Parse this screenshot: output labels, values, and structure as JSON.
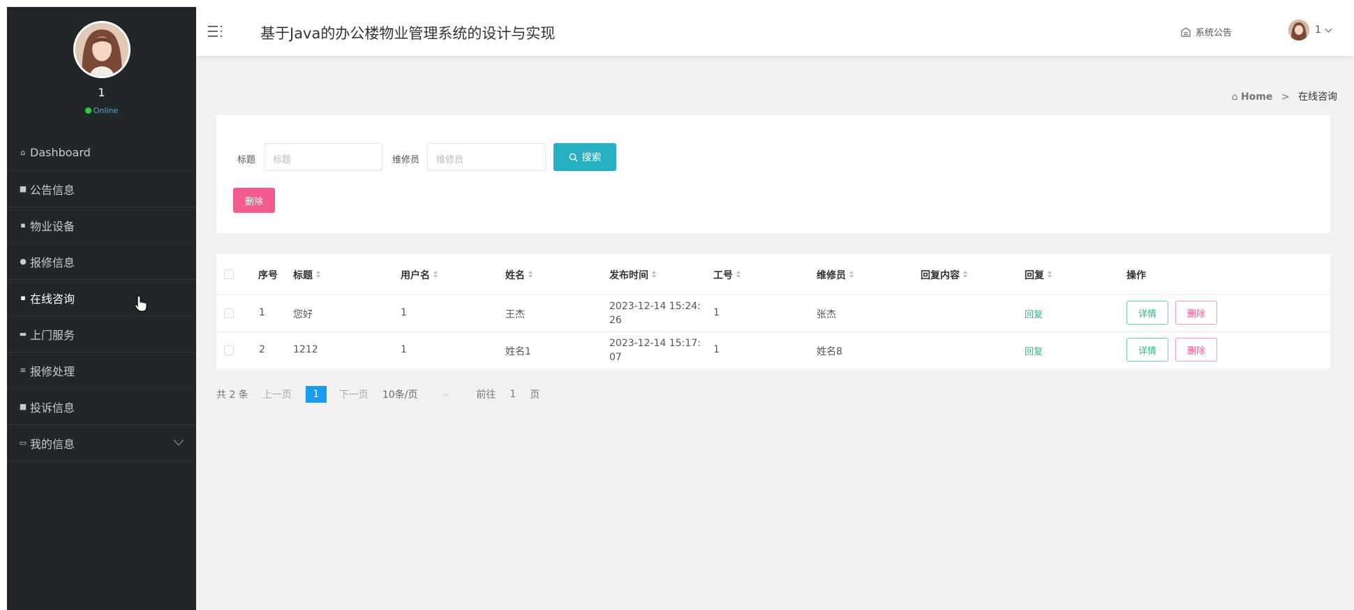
{
  "header": {
    "title": "基于Java的办公楼物业管理系统的设计与实现",
    "notice_label": "系统公告",
    "user_label": "1"
  },
  "sidebar": {
    "user_name": "1",
    "status": "Online",
    "items": [
      {
        "label": "Dashboard",
        "icon": "home-icon"
      },
      {
        "label": "公告信息",
        "icon": "comment-icon"
      },
      {
        "label": "物业设备",
        "icon": "grid-icon"
      },
      {
        "label": "报修信息",
        "icon": "map-pin-icon"
      },
      {
        "label": "在线咨询",
        "icon": "grid-icon"
      },
      {
        "label": "上门服务",
        "icon": "car-icon"
      },
      {
        "label": "报修处理",
        "icon": "list-icon"
      },
      {
        "label": "投诉信息",
        "icon": "comment-icon"
      },
      {
        "label": "我的信息",
        "icon": "window-icon"
      }
    ]
  },
  "breadcrumb": {
    "home": "Home",
    "separator": ">",
    "current": "在线咨询"
  },
  "search": {
    "title_label": "标题",
    "title_placeholder": "标题",
    "repair_label": "维修员",
    "repair_placeholder": "维修员",
    "search_button": "搜索",
    "delete_button": "删除"
  },
  "table": {
    "columns": [
      "序号",
      "标题",
      "用户名",
      "姓名",
      "发布时间",
      "工号",
      "维修员",
      "回复内容",
      "回复",
      "操作"
    ],
    "rows": [
      {
        "index": "1",
        "title": "您好",
        "username": "1",
        "name": "王杰",
        "time_line1": "2023-12-14 15:24:",
        "time_line2": "26",
        "job_no": "1",
        "repairer": "张杰",
        "reply_content": "",
        "reply": "回复",
        "detail": "详情",
        "delete": "删除"
      },
      {
        "index": "2",
        "title": "1212",
        "username": "1",
        "name": "姓名1",
        "time_line1": "2023-12-14 15:17:",
        "time_line2": "07",
        "job_no": "1",
        "repairer": "姓名8",
        "reply_content": "",
        "reply": "回复",
        "detail": "详情",
        "delete": "删除"
      }
    ]
  },
  "pagination": {
    "total": "共 2 条",
    "prev": "上一页",
    "current_page": "1",
    "next": "下一页",
    "page_size": "10条/页",
    "goto_label": "前往",
    "goto_value": "1",
    "page_unit": "页"
  },
  "colors": {
    "sidebar_bg": "#212629",
    "search_button": "#26b1c2",
    "delete_button": "#f35b8e",
    "page_active": "#1a9bf0",
    "reply_green": "#2cb87e"
  }
}
